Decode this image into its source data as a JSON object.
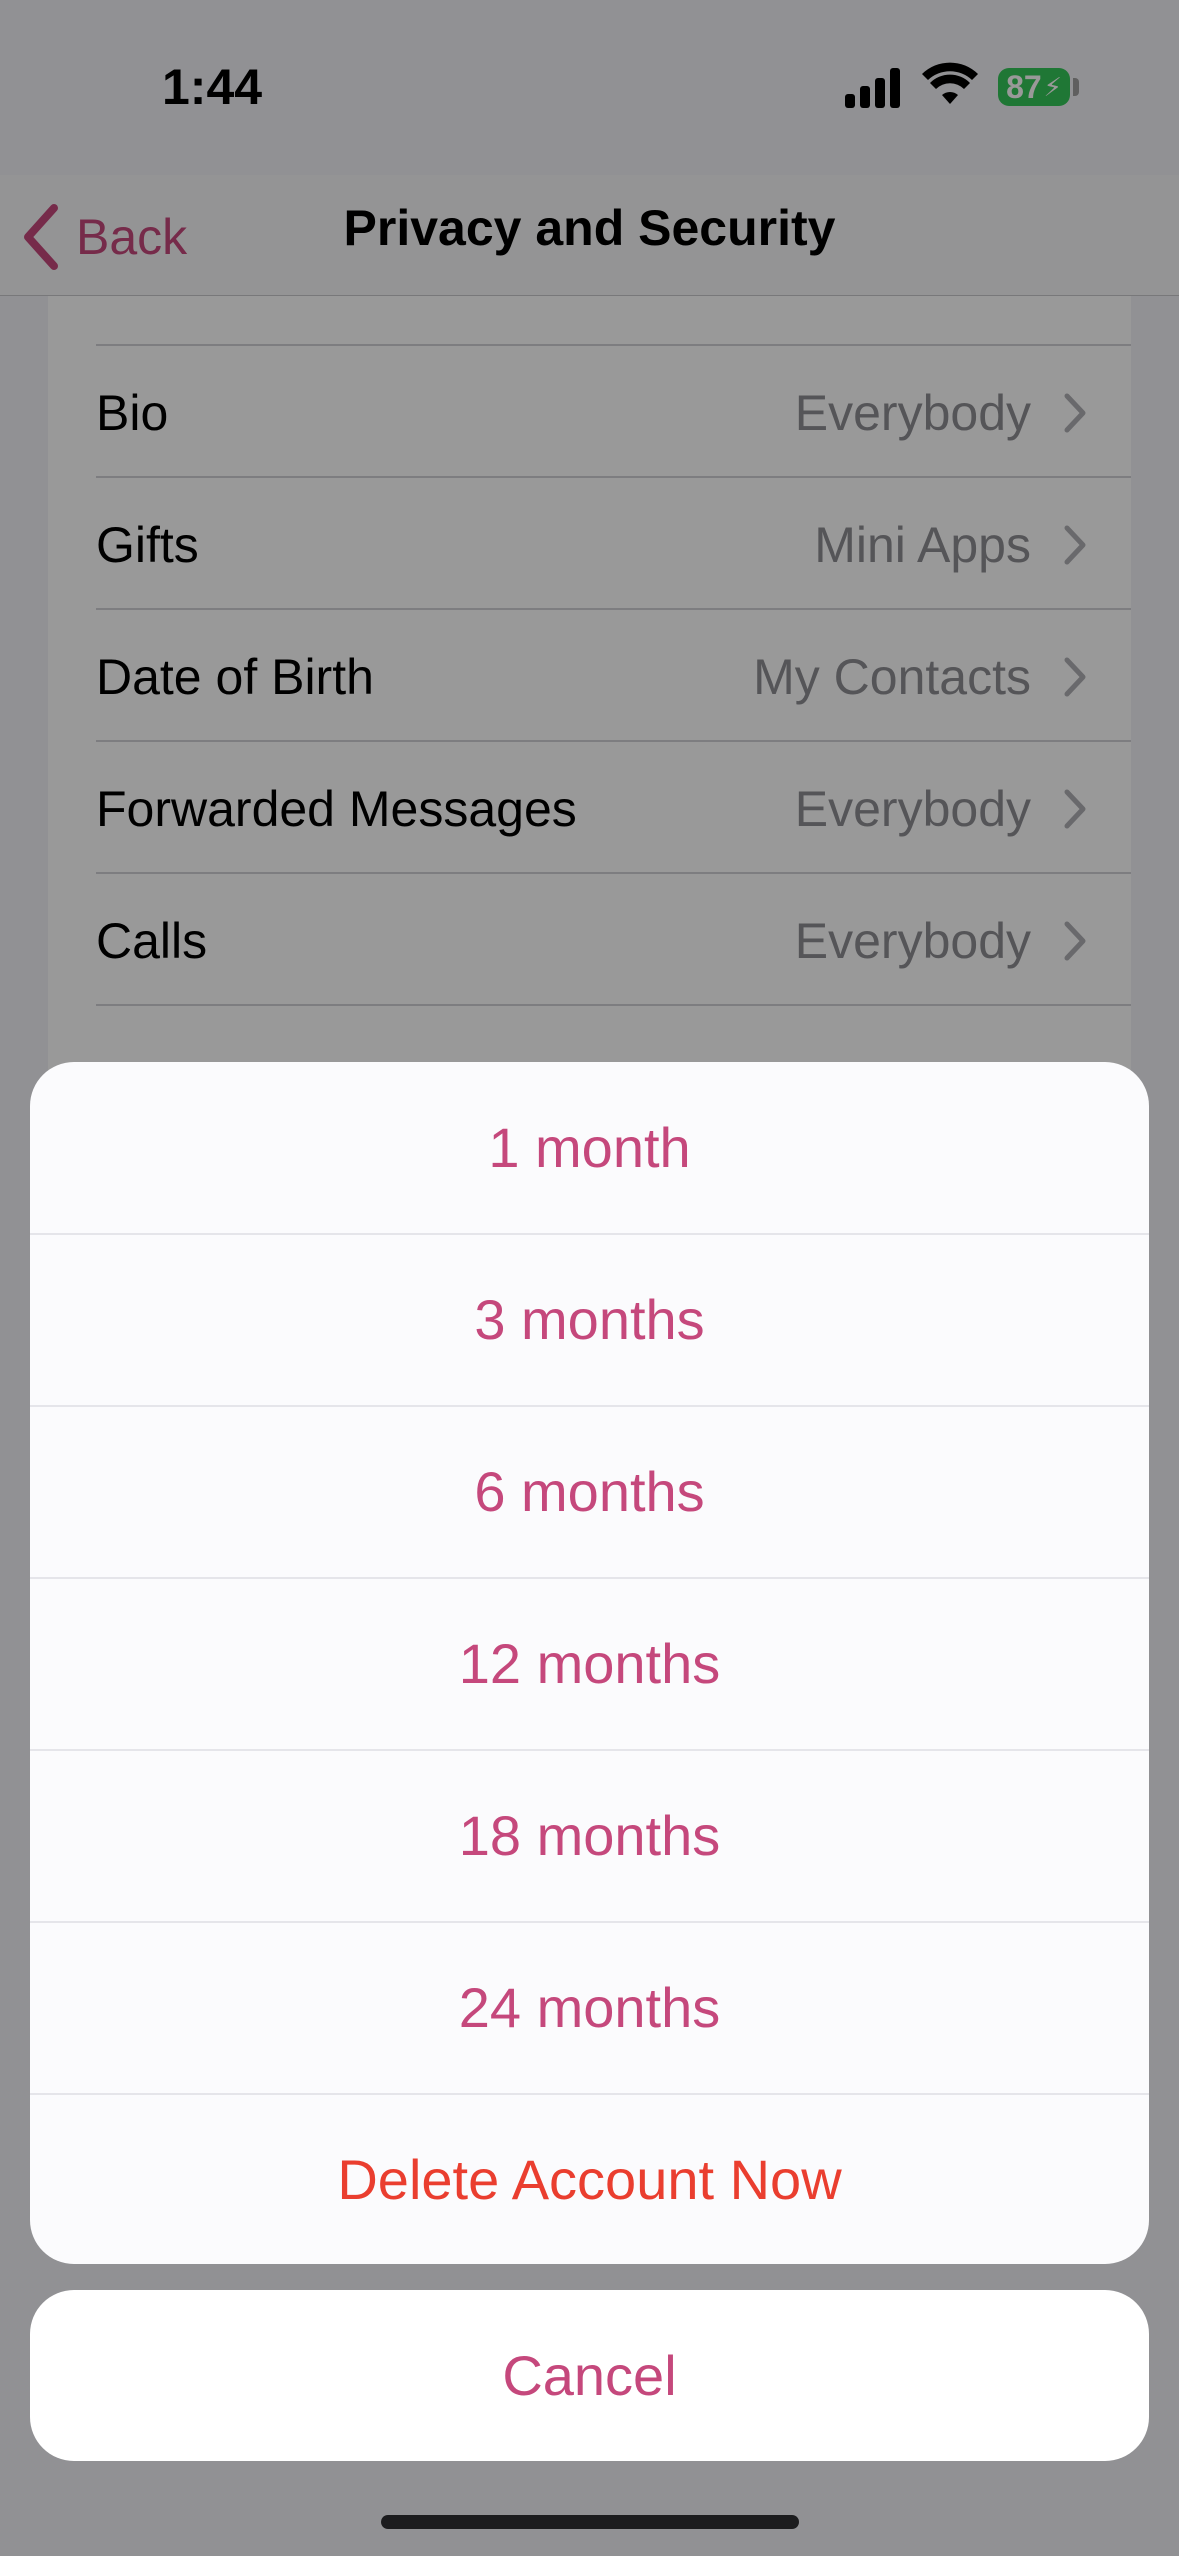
{
  "status_bar": {
    "time": "1:44",
    "battery": "87"
  },
  "nav": {
    "back_label": "Back",
    "title": "Privacy and Security"
  },
  "privacy_rows": [
    {
      "label": "Bio",
      "value": "Everybody"
    },
    {
      "label": "Gifts",
      "value": "Mini Apps"
    },
    {
      "label": "Date of Birth",
      "value": "My Contacts"
    },
    {
      "label": "Forwarded Messages",
      "value": "Everybody"
    },
    {
      "label": "Calls",
      "value": "Everybody"
    }
  ],
  "action_sheet": {
    "options": [
      {
        "label": "1 month"
      },
      {
        "label": "3 months"
      },
      {
        "label": "6 months"
      },
      {
        "label": "12 months"
      },
      {
        "label": "18 months"
      },
      {
        "label": "24 months"
      }
    ],
    "destructive_label": "Delete Account Now",
    "cancel_label": "Cancel"
  },
  "colors": {
    "accent": "#c5487c",
    "destructive": "#ea3e2f",
    "battery": "#34c759"
  }
}
